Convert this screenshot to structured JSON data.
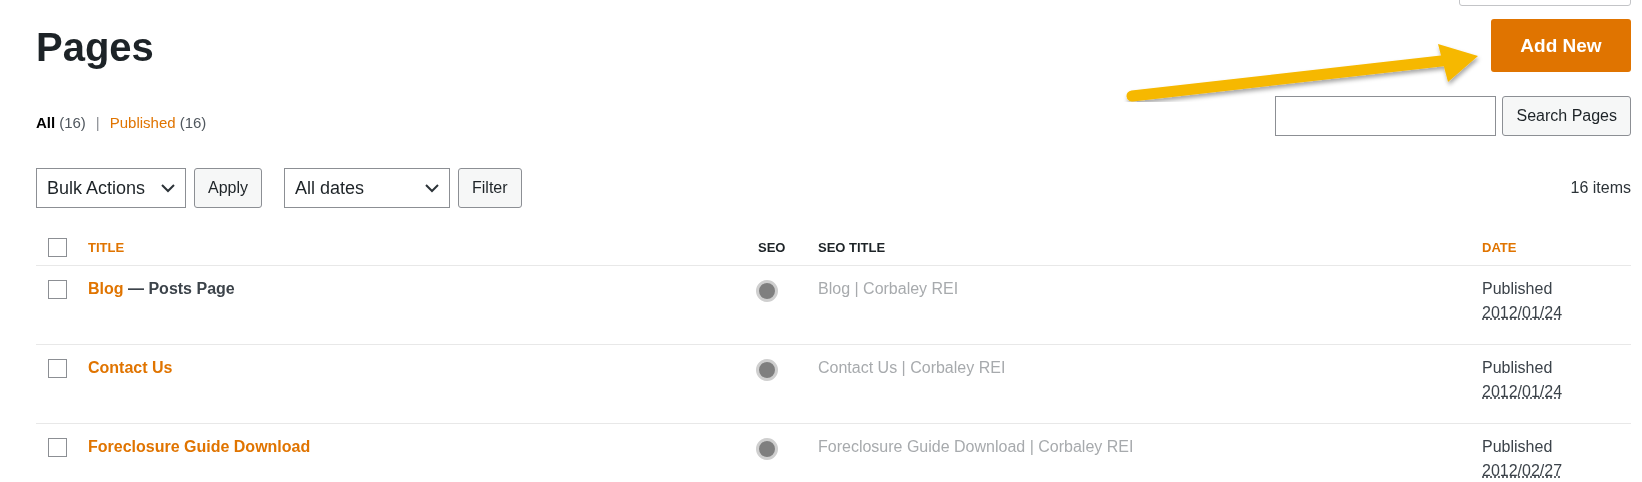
{
  "heading": "Pages",
  "add_new": "Add New",
  "views": [
    {
      "label": "All",
      "count": "(16)",
      "selected": true
    },
    {
      "label": "Published",
      "count": "(16)",
      "selected": false
    }
  ],
  "view_separator": "|",
  "search": {
    "button": "Search Pages"
  },
  "bulk_actions": {
    "value": "Bulk Actions",
    "button": "Apply"
  },
  "date_filter": {
    "value": "All dates",
    "button": "Filter"
  },
  "item_count": "16 items",
  "select_all": {
    "checked": false
  },
  "table": {
    "columns": [
      "TITLE",
      "SEO",
      "SEO TITLE",
      "DATE"
    ],
    "rows": [
      {
        "checked": false,
        "title": "Blog",
        "post_state": "— Posts Page",
        "seo_title": "Blog | Corbaley REI",
        "status": "Published",
        "date": "2012/01/24"
      },
      {
        "checked": false,
        "title": "Contact Us",
        "seo_title": "Contact Us | Corbaley REI",
        "status": "Published",
        "date": "2012/01/24"
      },
      {
        "checked": false,
        "title": "Foreclosure Guide Download",
        "seo_title": "Foreclosure Guide Download | Corbaley REI",
        "status": "Published",
        "date": "2012/02/27"
      }
    ]
  }
}
